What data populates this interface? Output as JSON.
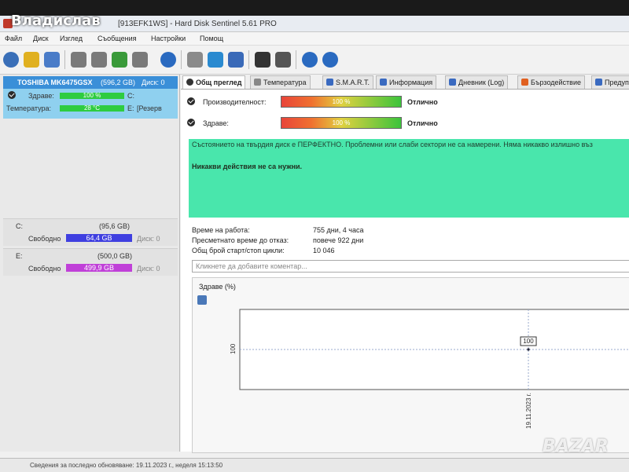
{
  "window": {
    "owner_overlay": "Владислав",
    "title": "[913EFK1WS] - Hard Disk Sentinel 5.61 PRO"
  },
  "menu": [
    "Файл",
    "Диск",
    "Изглед",
    "Съобщения",
    "Настройки",
    "Помощ"
  ],
  "toolbar": {
    "icons": [
      "refresh-icon",
      "warning-icon",
      "monitor-icon",
      "tool-icon",
      "tool-icon",
      "tool-icon",
      "tool-icon",
      "globe-icon",
      "report-icon",
      "cycle-icon",
      "network-icon",
      "alert-icon",
      "wrench-icon",
      "help-icon",
      "info-icon"
    ]
  },
  "disk": {
    "name": "TOSHIBA MK6475GSX",
    "size": "(596,2 GB)",
    "disk_index": "Диск: 0",
    "health_label": "Здраве:",
    "health_value": "100 %",
    "health_drive": "C:",
    "temp_label": "Температура:",
    "temp_value": "28 °C",
    "temp_drive": "E:",
    "temp_extra": "[Резерв"
  },
  "volumes": [
    {
      "letter": "C:",
      "size": "(95,6 GB)",
      "free_label": "Свободно",
      "free_value": "64,4 GB",
      "disk": "Диск: 0",
      "color": "#3f3fe0"
    },
    {
      "letter": "E:",
      "size": "(500,0 GB)",
      "free_label": "Свободно",
      "free_value": "499,9 GB",
      "disk": "Диск: 0",
      "color": "#c040d8"
    }
  ],
  "tabs": [
    {
      "label": "Общ преглед",
      "active": true
    },
    {
      "label": "Температура",
      "active": false
    },
    {
      "label": "S.M.A.R.T.",
      "active": false
    },
    {
      "label": "Информация",
      "active": false
    },
    {
      "label": "Дневник (Log)",
      "active": false
    },
    {
      "label": "Бързодействие",
      "active": false
    },
    {
      "label": "Предупр",
      "active": false
    }
  ],
  "overview": {
    "performance_label": "Производителност:",
    "performance_value": "100 %",
    "performance_status": "Отлично",
    "health_label": "Здраве:",
    "health_value": "100 %",
    "health_status": "Отлично",
    "status_msg": "Състоянието на твърдия диск е ПЕРФЕКТНО. Проблемни или слаби сектори не са намерени. Няма никакво излишно въз",
    "action_msg": "Никакви действия не са нужни.",
    "power_on_label": "Време на работа:",
    "power_on_value": "755 дни, 4 часа",
    "lifetime_label": "Пресметнато време до отказ:",
    "lifetime_value": "повече 922 дни",
    "cycles_label": "Общ брой старт/стоп цикли:",
    "cycles_value": "10 046",
    "comment_placeholder": "Кликнете да добавите коментар..."
  },
  "chart_data": {
    "type": "line",
    "title": "Здраве (%)",
    "x": [
      "19.11.2023 г."
    ],
    "series": [
      {
        "values": [
          100
        ]
      }
    ],
    "ytick": "100",
    "point_label": "100"
  },
  "statusbar": {
    "text": "Сведения за последно обновяване: 19.11.2023 г., неделя 15:13:50"
  },
  "watermark": "BAZAR"
}
